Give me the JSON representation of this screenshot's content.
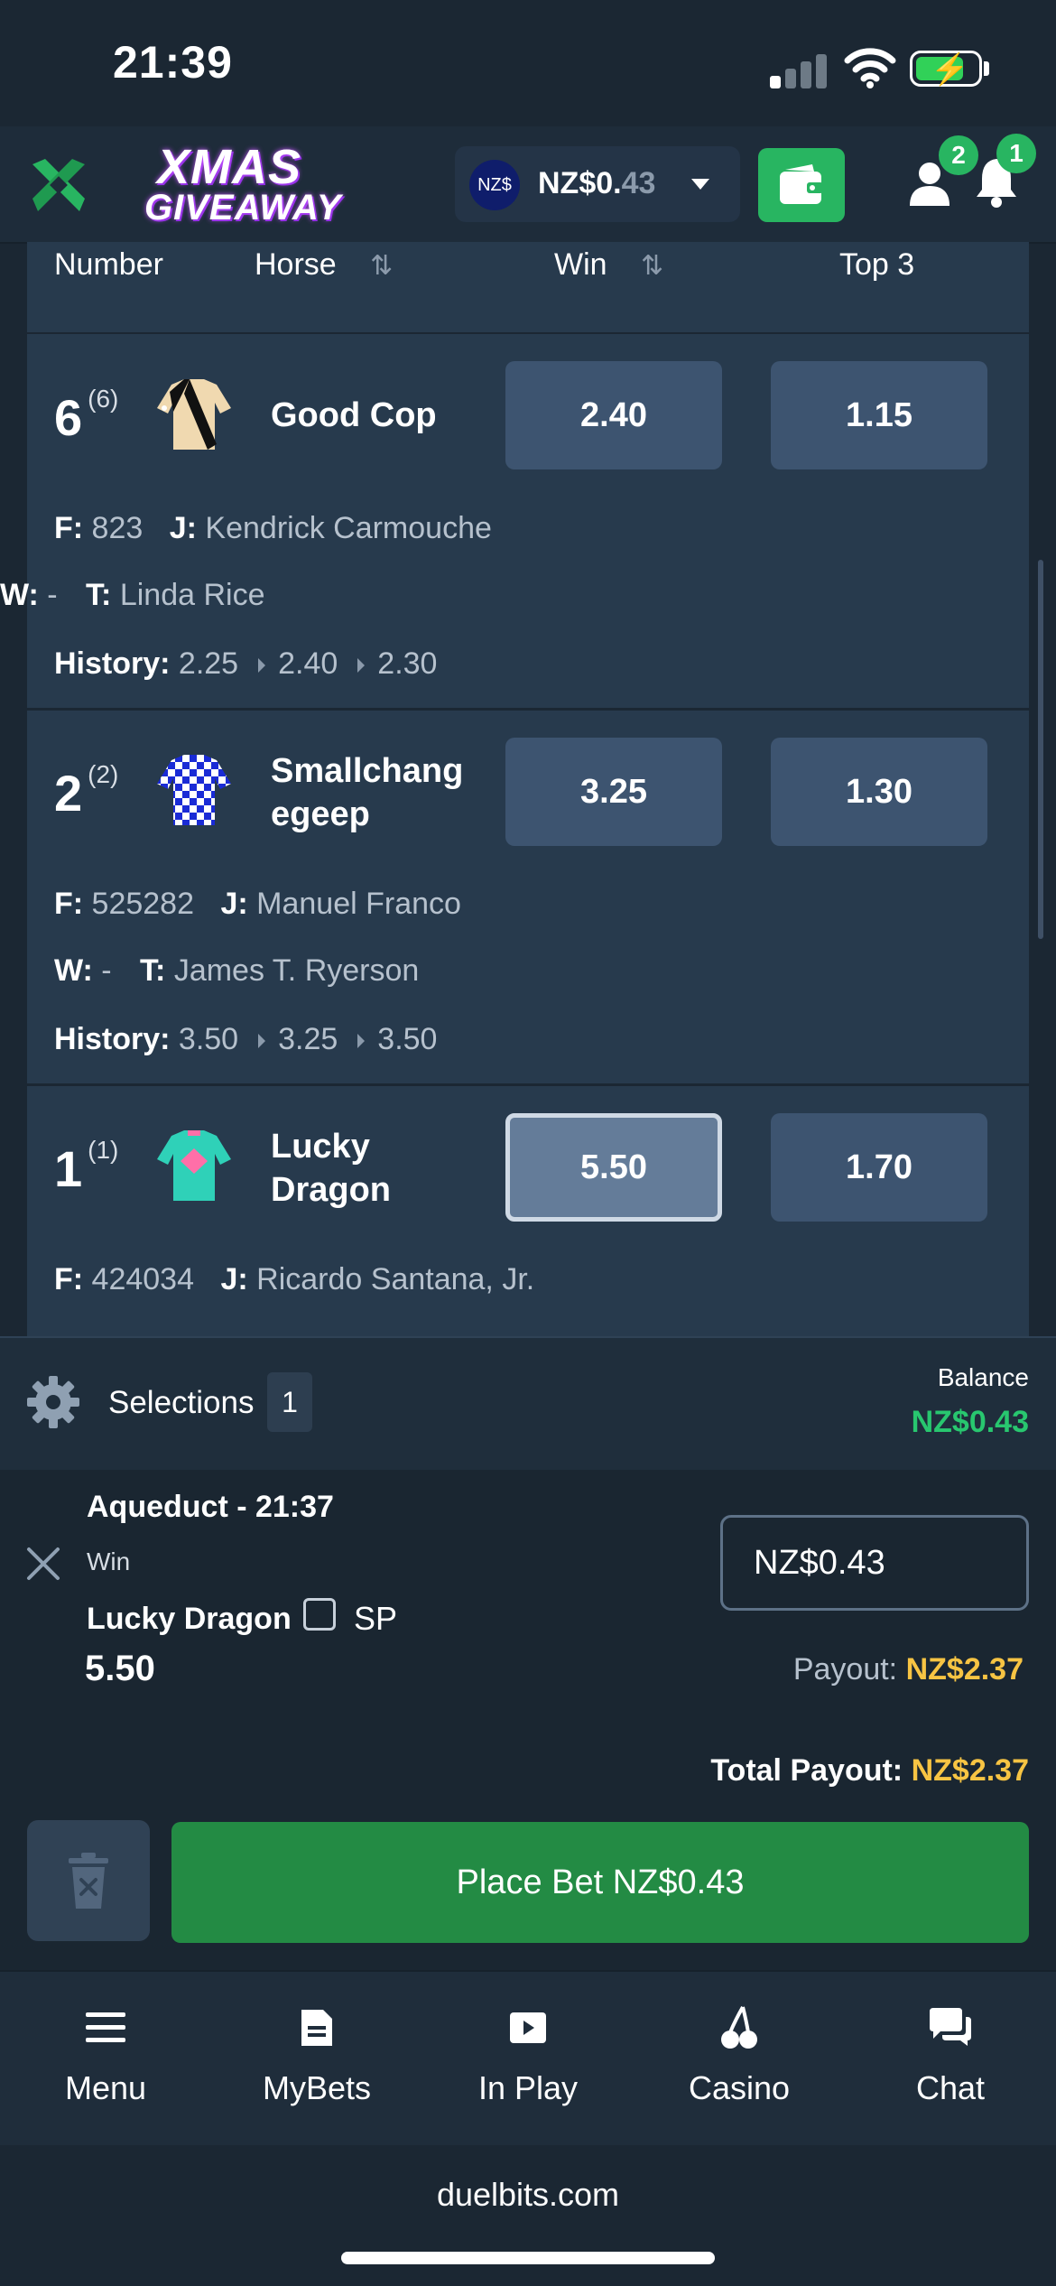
{
  "status_bar": {
    "time": "21:39"
  },
  "header": {
    "promo_line1": "XMAS",
    "promo_line2": "GIVEAWAY",
    "currency_badge": "NZ$",
    "balance_main": "NZ$0.",
    "balance_dim": "43",
    "profile_badge": "2",
    "notification_badge": "1",
    "icons": [
      "duelbits-logo-icon",
      "wallet-icon",
      "user-icon",
      "bell-icon"
    ]
  },
  "table": {
    "columns": {
      "number": "Number",
      "horse": "Horse",
      "win": "Win",
      "top3": "Top 3"
    },
    "runners": [
      {
        "number": "6",
        "draw": "(6)",
        "name": "Good Cop",
        "win": "2.40",
        "top3": "1.15",
        "f_label": "F:",
        "f_value": "823",
        "j_label": "J:",
        "jockey": "Kendrick Carmouche",
        "w_label": "W:",
        "w_value": "-",
        "t_label": "T:",
        "trainer": "Linda Rice",
        "history_label": "History:",
        "history": [
          "2.25",
          "2.40",
          "2.30"
        ]
      },
      {
        "number": "2",
        "draw": "(2)",
        "name": "Smallchang egeep",
        "win": "3.25",
        "top3": "1.30",
        "f_label": "F:",
        "f_value": "525282",
        "j_label": "J:",
        "jockey": "Manuel Franco",
        "w_label": "W:",
        "w_value": "-",
        "t_label": "T:",
        "trainer": "James T. Ryerson",
        "history_label": "History:",
        "history": [
          "3.50",
          "3.25",
          "3.50"
        ]
      },
      {
        "number": "1",
        "draw": "(1)",
        "name": "Lucky Dragon",
        "win": "5.50",
        "top3": "1.70",
        "f_label": "F:",
        "f_value": "424034",
        "j_label": "J:",
        "jockey": "Ricardo Santana, Jr.",
        "selected": "win"
      }
    ]
  },
  "betslip": {
    "selections_label": "Selections",
    "selections_count": "1",
    "balance_label": "Balance",
    "balance_value": "NZ$0.43",
    "bet": {
      "event": "Aqueduct - 21:37",
      "market": "Win",
      "selection": "Lucky Dragon",
      "sp_label": "SP",
      "odds": "5.50",
      "stake": "NZ$0.43",
      "payout_label": "Payout:",
      "payout_value": "NZ$2.37"
    },
    "total_label": "Total Payout:",
    "total_value": "NZ$2.37",
    "place_bet_label": "Place Bet NZ$0.43"
  },
  "bottom_nav": [
    {
      "label": "Menu",
      "icon": "menu-icon"
    },
    {
      "label": "MyBets",
      "icon": "document-icon"
    },
    {
      "label": "In Play",
      "icon": "play-icon"
    },
    {
      "label": "Casino",
      "icon": "cherries-icon"
    },
    {
      "label": "Chat",
      "icon": "chat-icon"
    }
  ],
  "browser": {
    "url": "duelbits.com"
  },
  "colors": {
    "accent_green": "#28b561",
    "payout_gold": "#f7c443",
    "balance_green": "#28c76f"
  }
}
